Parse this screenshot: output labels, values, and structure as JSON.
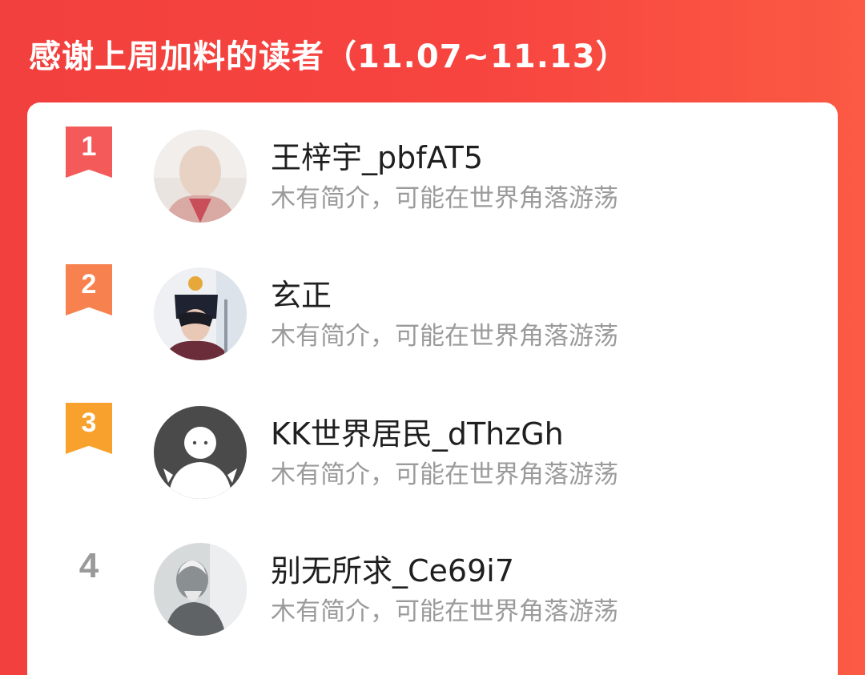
{
  "header": {
    "title": "感谢上周加料的读者（11.07~11.13）"
  },
  "colors": {
    "rank1": "#f55a5a",
    "rank2": "#f7824f",
    "rank3": "#f8a12d",
    "rank_plain": "#9a9a9a"
  },
  "readers": [
    {
      "rank": "1",
      "name": "王梓宇_pbfAT5",
      "bio": "木有简介，可能在世界角落游荡",
      "avatar_icon": "photo-avatar-icon"
    },
    {
      "rank": "2",
      "name": "玄正",
      "bio": "木有简介，可能在世界角落游荡",
      "avatar_icon": "anime-character-avatar-icon"
    },
    {
      "rank": "3",
      "name": "KK世界居民_dThzGh",
      "bio": "木有简介，可能在世界角落游荡",
      "avatar_icon": "default-user-avatar-icon"
    },
    {
      "rank": "4",
      "name": "别无所求_Ce69i7",
      "bio": "木有简介，可能在世界角落游荡",
      "avatar_icon": "grayscale-photo-avatar-icon"
    }
  ]
}
